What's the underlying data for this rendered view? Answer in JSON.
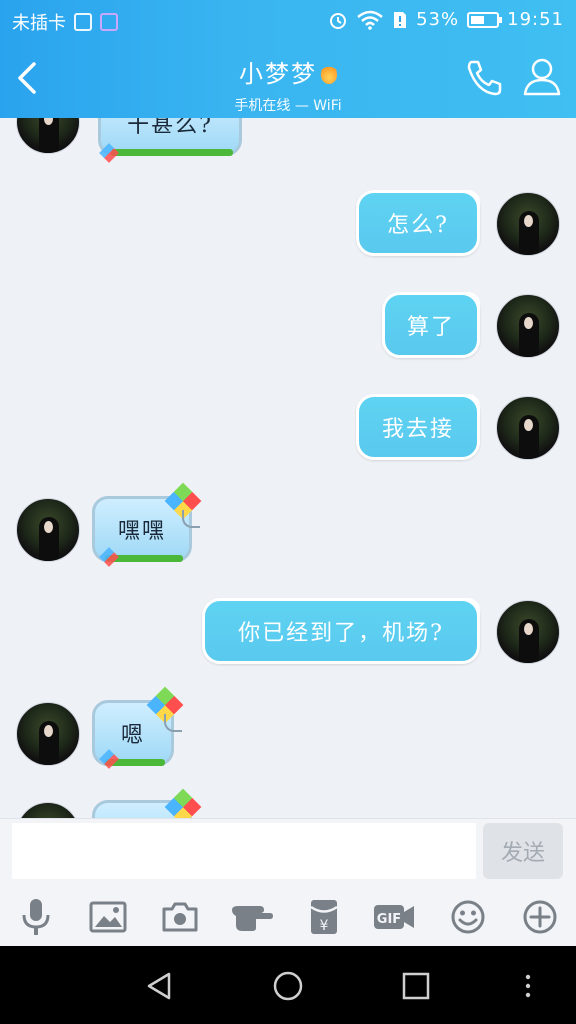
{
  "status_bar": {
    "carrier": "未插卡",
    "battery_percent": "53%",
    "battery_level": 0.53,
    "time": "19:51"
  },
  "header": {
    "title": "小梦梦",
    "subtitle": "手机在线 — WiFi",
    "gradient_start": "#2aa3ee",
    "gradient_end": "#40bff2"
  },
  "messages": [
    {
      "side": "in",
      "text": "干甚么?"
    },
    {
      "side": "out",
      "text": "怎么?"
    },
    {
      "side": "out",
      "text": "算了"
    },
    {
      "side": "out",
      "text": "我去接"
    },
    {
      "side": "in",
      "text": "嘿嘿"
    },
    {
      "side": "out",
      "text": "你已经到了，机场?"
    },
    {
      "side": "in",
      "text": "嗯"
    },
    {
      "side": "in",
      "text": ""
    }
  ],
  "composer": {
    "input_value": "",
    "send_label": "发送"
  },
  "toolbar": {
    "icons": [
      "microphone-icon",
      "image-icon",
      "camera-icon",
      "poke-icon",
      "red-packet-icon",
      "gif-icon",
      "emoji-icon",
      "plus-icon"
    ],
    "gif_text": "GIF",
    "yen_text": "¥"
  },
  "colors": {
    "accent": "#39b4f0",
    "bubble_out": "#5fd3f2",
    "bubble_in": "#b8e4fa",
    "chat_bg": "#eef1f6"
  }
}
